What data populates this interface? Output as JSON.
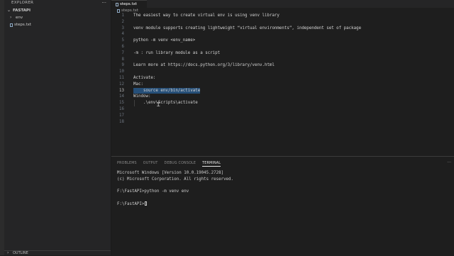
{
  "sidebar": {
    "title": "EXPLORER",
    "more_label": "···",
    "folder": {
      "label": "FASTAPI"
    },
    "items": [
      {
        "label": "env",
        "kind": "folder"
      },
      {
        "label": "steps.txt",
        "kind": "file"
      }
    ],
    "outline_label": "OUTLINE"
  },
  "editor": {
    "active_tab": "steps.txt",
    "breadcrumb": "steps.txt",
    "lines": [
      {
        "n": "1",
        "text": "The easiest way to create virtual env is using venv library"
      },
      {
        "n": "2",
        "text": ""
      },
      {
        "n": "3",
        "text": "venv module supports creating lightweight “virtual environments”, independent set of package"
      },
      {
        "n": "4",
        "text": ""
      },
      {
        "n": "5",
        "text": "python -m venv <env_name>"
      },
      {
        "n": "6",
        "text": ""
      },
      {
        "n": "7",
        "text": "-m : run library module as a script"
      },
      {
        "n": "8",
        "text": ""
      },
      {
        "n": "9",
        "text": "Learn more at https://docs.python.org/3/library/venv.html"
      },
      {
        "n": "10",
        "text": ""
      },
      {
        "n": "11",
        "text": "Activate:"
      },
      {
        "n": "12",
        "text": "Mac:"
      },
      {
        "n": "13",
        "text": "    source env/bin/activate"
      },
      {
        "n": "14",
        "text": "Window:"
      },
      {
        "n": "15",
        "text": "    .\\env\\Scripts\\activate"
      },
      {
        "n": "16",
        "text": ""
      },
      {
        "n": "17",
        "text": ""
      },
      {
        "n": "18",
        "text": ""
      }
    ]
  },
  "panel": {
    "tabs": [
      "PROBLEMS",
      "OUTPUT",
      "DEBUG CONSOLE",
      "TERMINAL"
    ],
    "active_tab": "TERMINAL",
    "more_label": "···",
    "terminal_lines": [
      "Microsoft Windows [Version 10.0.19045.2728]",
      "(c) Microsoft Corporation. All rights reserved.",
      "",
      "F:\\FastAPI>python -m venv env",
      "",
      "F:\\FastAPI>"
    ]
  }
}
